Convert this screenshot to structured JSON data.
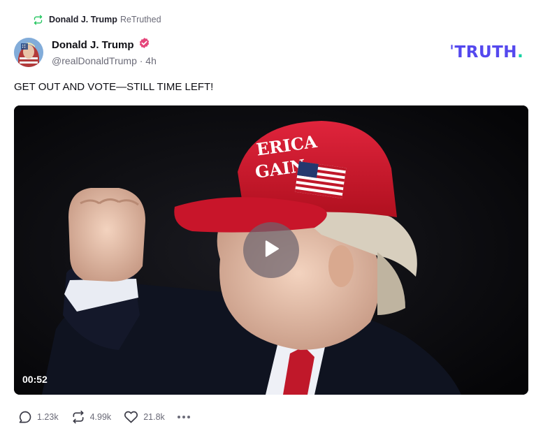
{
  "retruth": {
    "name": "Donald J. Trump",
    "suffix": "ReTruthed",
    "icon": "retruth-icon",
    "icon_color": "#22c55e"
  },
  "author": {
    "name": "Donald J. Trump",
    "handle": "@realDonaldTrump · 4h",
    "verified_icon": "verified-badge-icon",
    "verified_color": "#e5457a",
    "avatar": "avatar"
  },
  "logo": {
    "word": "TRUTH",
    "dot": ".",
    "brand_color": "#5448ee",
    "dot_color": "#17d1a3"
  },
  "post": {
    "text": "GET OUT AND VOTE—STILL TIME LEFT!"
  },
  "video": {
    "duration": "00:52",
    "play_icon": "play-icon"
  },
  "actions": {
    "replies": "1.23k",
    "retruths": "4.99k",
    "likes": "21.8k",
    "reply_icon": "reply-icon",
    "retruth_icon": "retruth-icon",
    "like_icon": "heart-icon",
    "more_icon": "more-icon"
  }
}
